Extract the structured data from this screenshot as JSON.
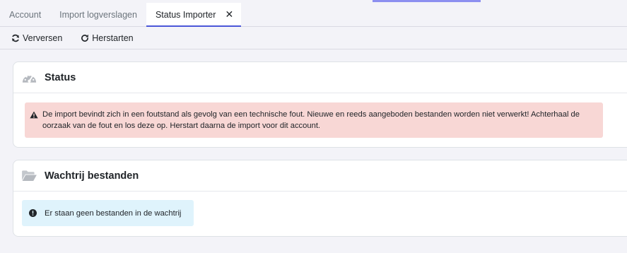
{
  "tabs": [
    {
      "label": "Account",
      "active": false
    },
    {
      "label": "Import logverslagen",
      "active": false
    },
    {
      "label": "Status Importer",
      "active": true
    }
  ],
  "tab_close_icon": "close-icon",
  "toolbar": {
    "refresh_label": "Verversen",
    "restart_label": "Herstarten"
  },
  "status_card": {
    "title": "Status",
    "icon": "gauge-icon",
    "alert": {
      "type": "danger",
      "icon": "warning-icon",
      "text": "De import bevindt zich in een foutstand als gevolg van een technische fout. Nieuwe en reeds aangeboden bestanden worden niet verwerkt! Achterhaal de oorzaak van de fout en los deze op. Herstart daarna de import voor dit account."
    }
  },
  "queue_card": {
    "title": "Wachtrij bestanden",
    "icon": "folder-open-icon",
    "alert": {
      "type": "info",
      "icon": "info-icon",
      "text": "Er staan geen bestanden in de wachtrij"
    }
  },
  "colors": {
    "background": "#f3f3f8",
    "accent": "#4a56d8",
    "danger_bg": "#f8d7d5",
    "info_bg": "#dff3fc"
  }
}
